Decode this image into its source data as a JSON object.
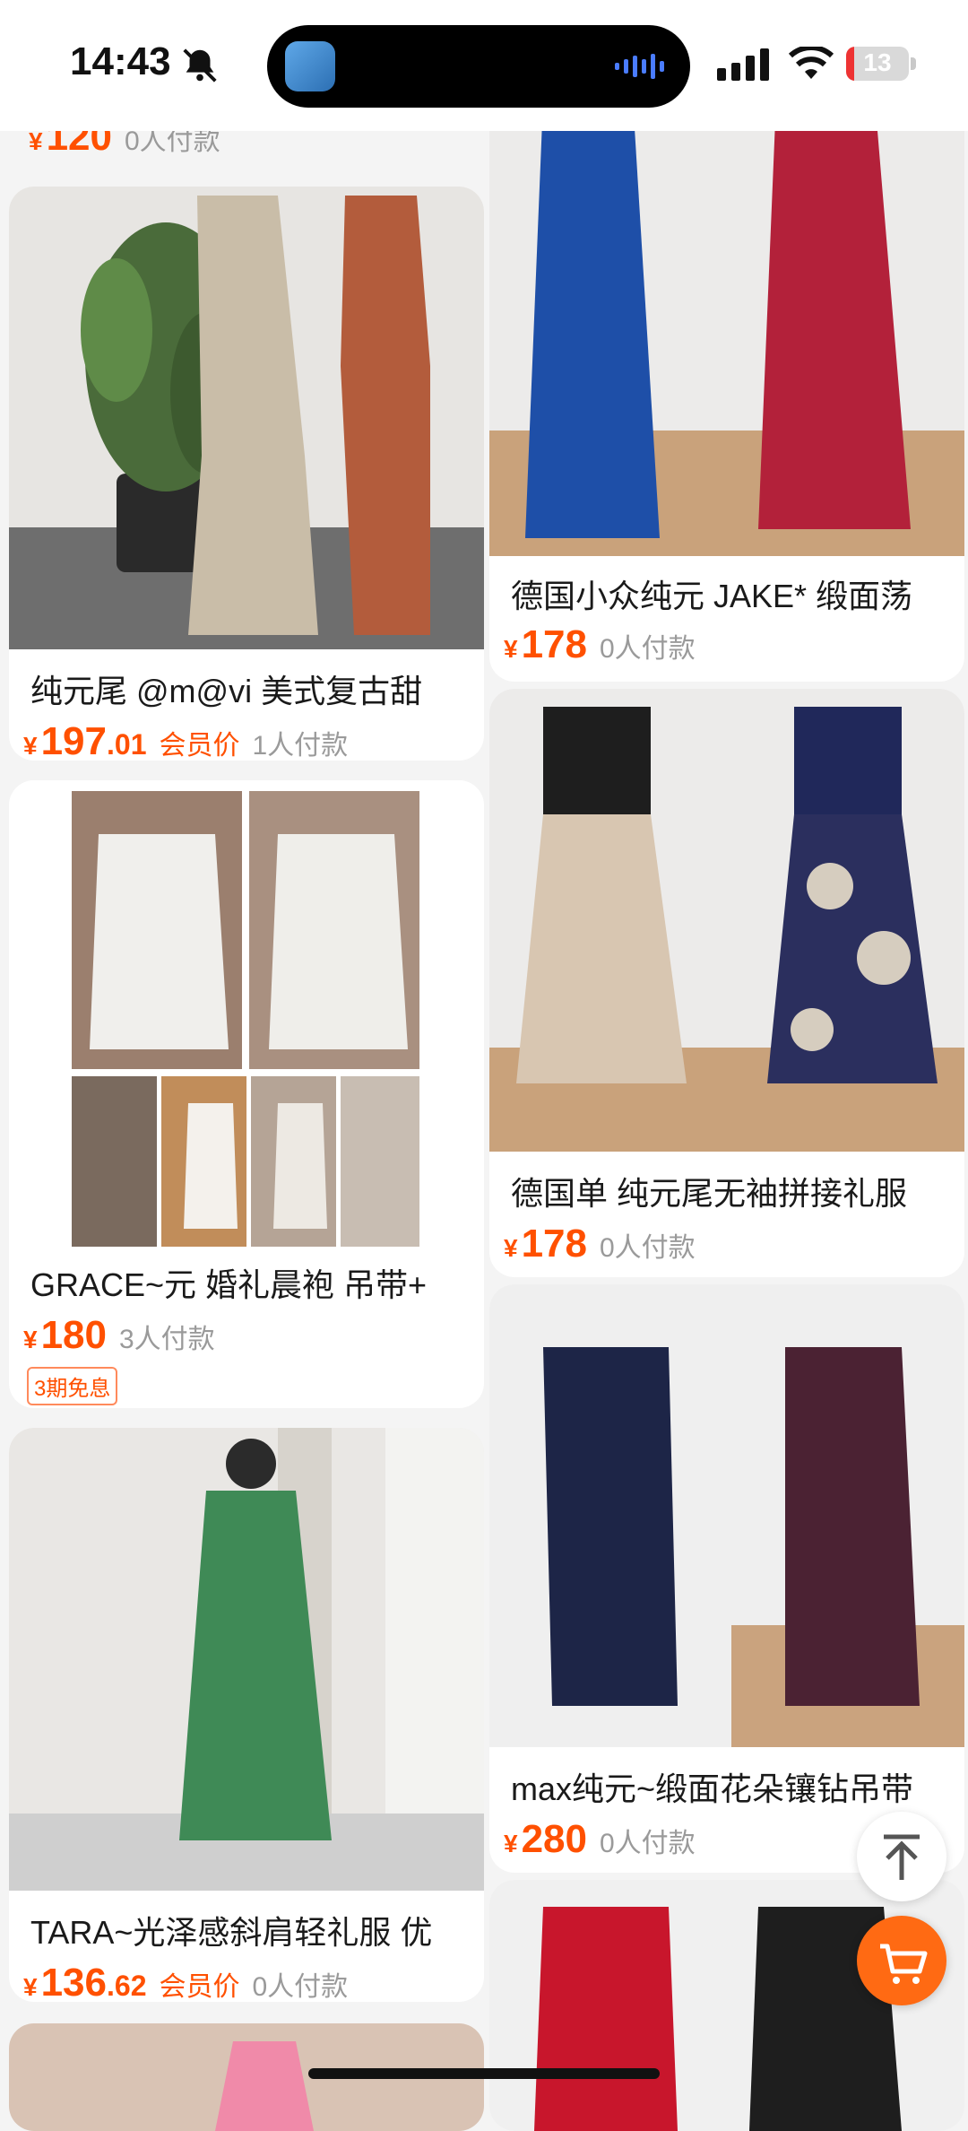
{
  "status_bar": {
    "time": "14:43",
    "battery": "13"
  },
  "products": [
    {
      "id": "top-partial",
      "price": "120",
      "paid": "0人付款"
    },
    {
      "id": "satin-slip",
      "title": "纯元尾 @m@vi 美式复古甜",
      "price": "197",
      "cents": ".01",
      "member": "会员价",
      "paid": "1人付款"
    },
    {
      "id": "robe",
      "title": "GRACE~元 婚礼晨袍 吊带+",
      "price": "180",
      "paid": "3人付款",
      "badge": "3期免息"
    },
    {
      "id": "green-dress",
      "title": "TARA~光泽感斜肩轻礼服 优",
      "price": "136",
      "cents": ".62",
      "member": "会员价",
      "paid": "0人付款"
    },
    {
      "id": "blue-red-gowns",
      "title": "德国小众纯元 JAKE* 缎面荡",
      "price": "178",
      "paid": "0人付款"
    },
    {
      "id": "floral-skirt",
      "title": "德国单 纯元尾无袖拼接礼服",
      "price": "178",
      "paid": "0人付款"
    },
    {
      "id": "navy-slip",
      "title": "max纯元~缎面花朵镶钻吊带",
      "price": "280",
      "paid": "0人付款"
    }
  ],
  "currency": "¥",
  "icons": {
    "scroll_top": "arrow-up-icon",
    "cart": "cart-icon"
  },
  "colors": {
    "price": "#ff5000",
    "cart_fab": "#ff6a13"
  }
}
